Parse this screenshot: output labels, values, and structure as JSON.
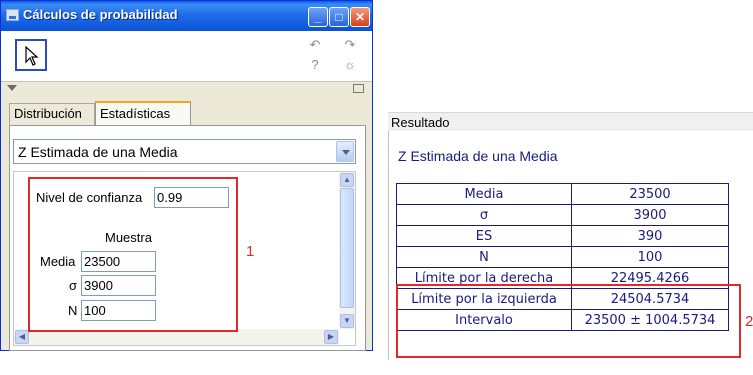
{
  "window": {
    "title": "Cálculos de probabilidad",
    "title_buttons": {
      "minimize": "_",
      "maximize": "□",
      "close": "✕"
    }
  },
  "toolbar": {
    "undo_icon": "↶",
    "redo_icon": "↷",
    "help_icon": "?",
    "settings_icon": "☼"
  },
  "tabs": [
    {
      "label": "Distribución",
      "active": false
    },
    {
      "label": "Estadísticas",
      "active": true
    }
  ],
  "procedure_select": {
    "value": "Z Estimada de una Media"
  },
  "form": {
    "confidence_label": "Nivel de confianza",
    "confidence_value": "0.99",
    "sample_heading": "Muestra",
    "fields": [
      {
        "label": "Media",
        "value": "23500"
      },
      {
        "label": "σ",
        "value": "3900"
      },
      {
        "label": "N",
        "value": "100"
      }
    ]
  },
  "annotations": {
    "left_marker": "1",
    "right_marker": "2",
    "marker_color": "#e02a2a"
  },
  "result": {
    "header": "Resultado",
    "title": "Z Estimada de una Media",
    "rows": [
      {
        "label": "Media",
        "value": "23500"
      },
      {
        "label": "σ",
        "value": "3900"
      },
      {
        "label": "ES",
        "value": "390"
      },
      {
        "label": "N",
        "value": "100"
      },
      {
        "label": "Límite por la derecha",
        "value": "22495.4266"
      },
      {
        "label": "Límite por la izquierda",
        "value": "24504.5734"
      },
      {
        "label": "Intervalo",
        "value": "23500 ± 1004.5734"
      }
    ],
    "text_color": "#1a1a80"
  }
}
